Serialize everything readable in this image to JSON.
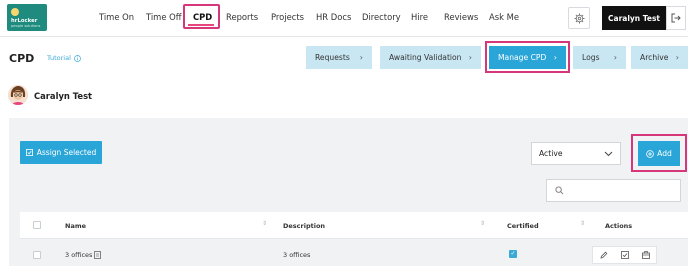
{
  "logo": {
    "line1": "hrLocker",
    "line2": "people solutions"
  },
  "nav": [
    {
      "label": "Time On"
    },
    {
      "label": "Time Off"
    },
    {
      "label": "CPD"
    },
    {
      "label": "Reports"
    },
    {
      "label": "Projects"
    },
    {
      "label": "HR Docs"
    },
    {
      "label": "Directory"
    },
    {
      "label": "Hire"
    },
    {
      "label": "Reviews"
    },
    {
      "label": "Ask Me"
    }
  ],
  "user": {
    "name": "Caralyn Test"
  },
  "page": {
    "title": "CPD",
    "tutorial": "Tutorial"
  },
  "crumbs": [
    {
      "label": "Requests"
    },
    {
      "label": "Awaiting Validation"
    },
    {
      "label": "Manage CPD"
    },
    {
      "label": "Logs"
    },
    {
      "label": "Archive"
    }
  ],
  "person": {
    "name": "Caralyn Test"
  },
  "toolbar": {
    "assign_label": "Assign Selected",
    "filter_value": "Active",
    "add_label": "Add"
  },
  "search": {
    "placeholder": ""
  },
  "table": {
    "headers": [
      "Name",
      "Description",
      "Certified",
      "Actions"
    ],
    "rows": [
      {
        "name": "3 offices",
        "description": "3 offices",
        "certified": true
      }
    ]
  },
  "colors": {
    "accent": "#2aa5d8",
    "highlight": "#d6377a",
    "light_accent": "#c9e6f3"
  }
}
